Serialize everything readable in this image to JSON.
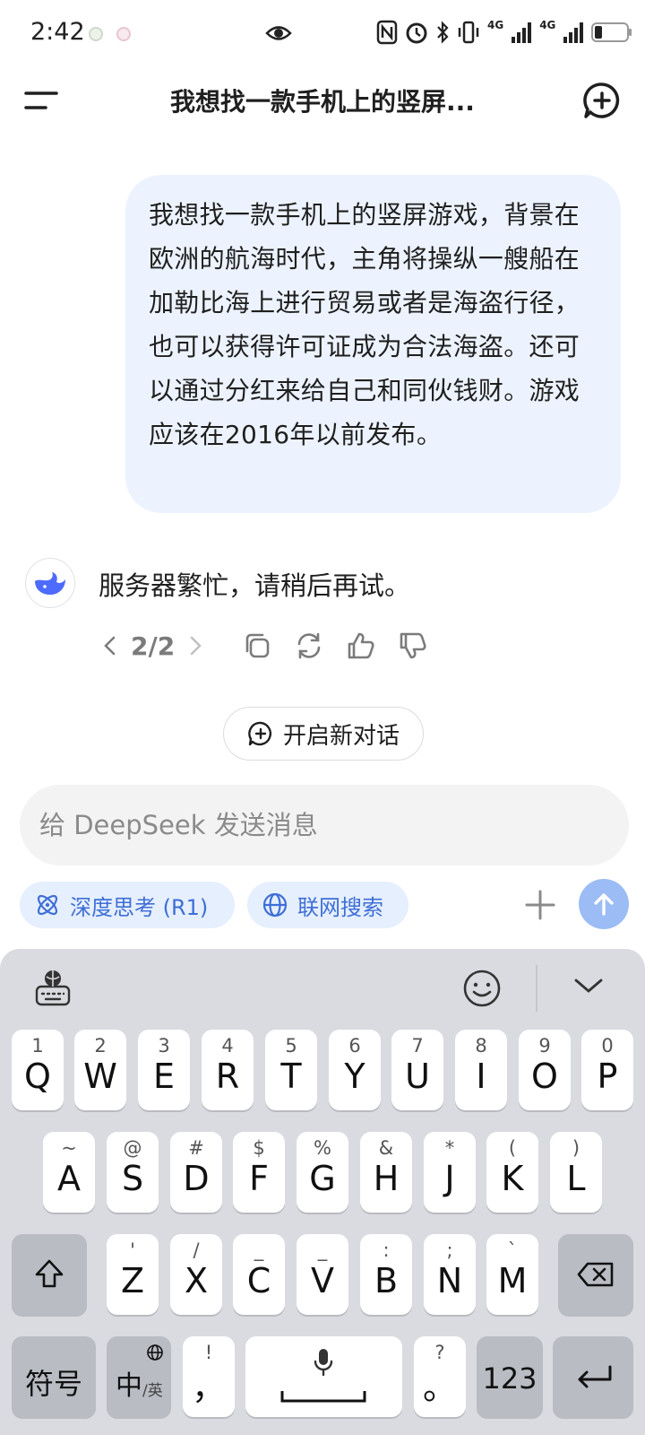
{
  "status_bar": {
    "time": "2:42",
    "network_1": "4G",
    "network_2": "4G"
  },
  "header": {
    "title": "我想找一款手机上的竖屏...",
    "menu_icon": "menu-icon",
    "new_chat_icon": "chat-plus-icon"
  },
  "conversation": {
    "user_message": "我想找一款手机上的竖屏游戏，背景在欧洲的航海时代，主角将操纵一艘船在加勒比海上进行贸易或者是海盗行径，也可以获得许可证成为合法海盗。还可以通过分红来给自己和同伙钱财。游戏应该在2016年以前发布。",
    "assistant_message": "服务器繁忙，请稍后再试。",
    "pager": "2/2"
  },
  "new_dialog_label": "开启新对话",
  "input": {
    "placeholder": "给 DeepSeek 发送消息"
  },
  "chips": {
    "deep_think": "深度思考 (R1)",
    "web_search": "联网搜索"
  },
  "colors": {
    "accent": "#4d6bfe",
    "bubble": "#edf3fe",
    "chip_bg": "#e6effd",
    "chip_text": "#3e6fd6",
    "send_disabled": "#9bbcf5"
  },
  "keyboard": {
    "row1": [
      {
        "sub": "1",
        "main": "Q"
      },
      {
        "sub": "2",
        "main": "W"
      },
      {
        "sub": "3",
        "main": "E"
      },
      {
        "sub": "4",
        "main": "R"
      },
      {
        "sub": "5",
        "main": "T"
      },
      {
        "sub": "6",
        "main": "Y"
      },
      {
        "sub": "7",
        "main": "U"
      },
      {
        "sub": "8",
        "main": "I"
      },
      {
        "sub": "9",
        "main": "O"
      },
      {
        "sub": "0",
        "main": "P"
      }
    ],
    "row2": [
      {
        "sub": "~",
        "main": "A"
      },
      {
        "sub": "@",
        "main": "S"
      },
      {
        "sub": "#",
        "main": "D"
      },
      {
        "sub": "$",
        "main": "F"
      },
      {
        "sub": "%",
        "main": "G"
      },
      {
        "sub": "&",
        "main": "H"
      },
      {
        "sub": "*",
        "main": "J"
      },
      {
        "sub": "(",
        "main": "K"
      },
      {
        "sub": ")",
        "main": "L"
      }
    ],
    "row3": [
      {
        "sub": "'",
        "main": "Z"
      },
      {
        "sub": "/",
        "main": "X"
      },
      {
        "sub": "_",
        "main": "C"
      },
      {
        "sub": "_",
        "main": "V"
      },
      {
        "sub": ":",
        "main": "B"
      },
      {
        "sub": ";",
        "main": "N"
      },
      {
        "sub": "`",
        "main": "M"
      }
    ],
    "symbols_label": "符号",
    "lang_label": "中",
    "lang_sub": "/英",
    "comma_sub": "!",
    "comma": "，",
    "period_sub": "?",
    "period": "。",
    "num_label": "123"
  }
}
